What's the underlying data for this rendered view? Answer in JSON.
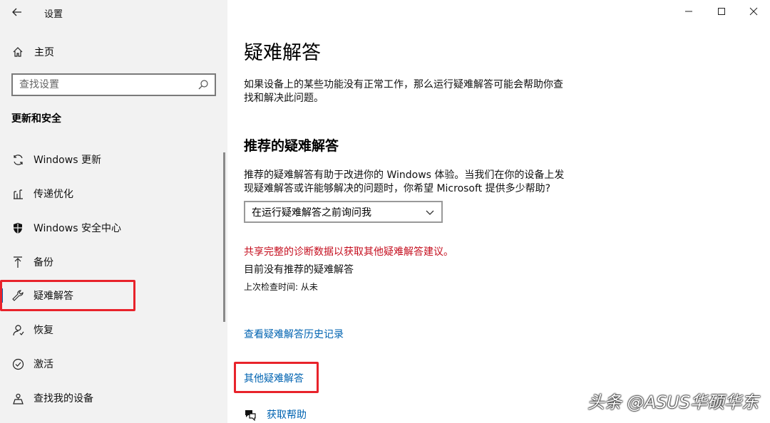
{
  "window": {
    "app_title": "设置",
    "controls": [
      "minimize-icon",
      "maximize-icon",
      "close-icon"
    ]
  },
  "sidebar": {
    "home_label": "主页",
    "search_placeholder": "查找设置",
    "section_title": "更新和安全",
    "items": [
      {
        "label": "Windows 更新",
        "icon": "sync-icon"
      },
      {
        "label": "传递优化",
        "icon": "delivery-optimization-icon"
      },
      {
        "label": "Windows 安全中心",
        "icon": "shield-icon"
      },
      {
        "label": "备份",
        "icon": "backup-icon"
      },
      {
        "label": "疑难解答",
        "icon": "wrench-icon",
        "selected": true
      },
      {
        "label": "恢复",
        "icon": "recovery-icon"
      },
      {
        "label": "激活",
        "icon": "check-circle-icon"
      },
      {
        "label": "查找我的设备",
        "icon": "find-device-icon"
      }
    ]
  },
  "main": {
    "title": "疑难解答",
    "intro": "如果设备上的某些功能没有正常工作，那么运行疑难解答可能会帮助你查找和解决此问题。",
    "recommended_heading": "推荐的疑难解答",
    "recommended_desc": "推荐的疑难解答有助于改进你的 Windows 体验。当我们在你的设备上发现疑难解答或许能够解决的问题时，你希望 Microsoft 提供多少帮助?",
    "dropdown_value": "在运行疑难解答之前询问我",
    "warning": "共享完整的诊断数据以获取其他疑难解答建议。",
    "no_recommended": "目前没有推荐的疑难解答",
    "last_checked": "上次检查时间: 从未",
    "history_link": "查看疑难解答历史记录",
    "other_link": "其他疑难解答",
    "help_link": "获取帮助"
  },
  "watermark": "头条 @ASUS华硕华东",
  "colors": {
    "accent": "#0063b1",
    "highlight_box": "#e8232b",
    "warning_text": "#c50f1f",
    "sidebar_bg": "#f2f2f2"
  }
}
